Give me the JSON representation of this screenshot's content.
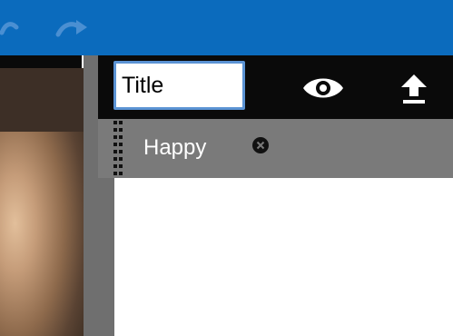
{
  "toolbar": {
    "title_value": "Title",
    "undo_icon": "undo-icon",
    "redo_icon": "redo-icon",
    "preview_icon": "eye-icon",
    "upload_icon": "upload-icon"
  },
  "tags": [
    {
      "label": "Happy",
      "remove_icon": "close-circle-icon"
    }
  ],
  "colors": {
    "topbar": "#0b6bbd",
    "toolbar": "#0a0a0a",
    "tagbar": "#7a7a7a",
    "input_focus_border": "#5b93d4"
  }
}
